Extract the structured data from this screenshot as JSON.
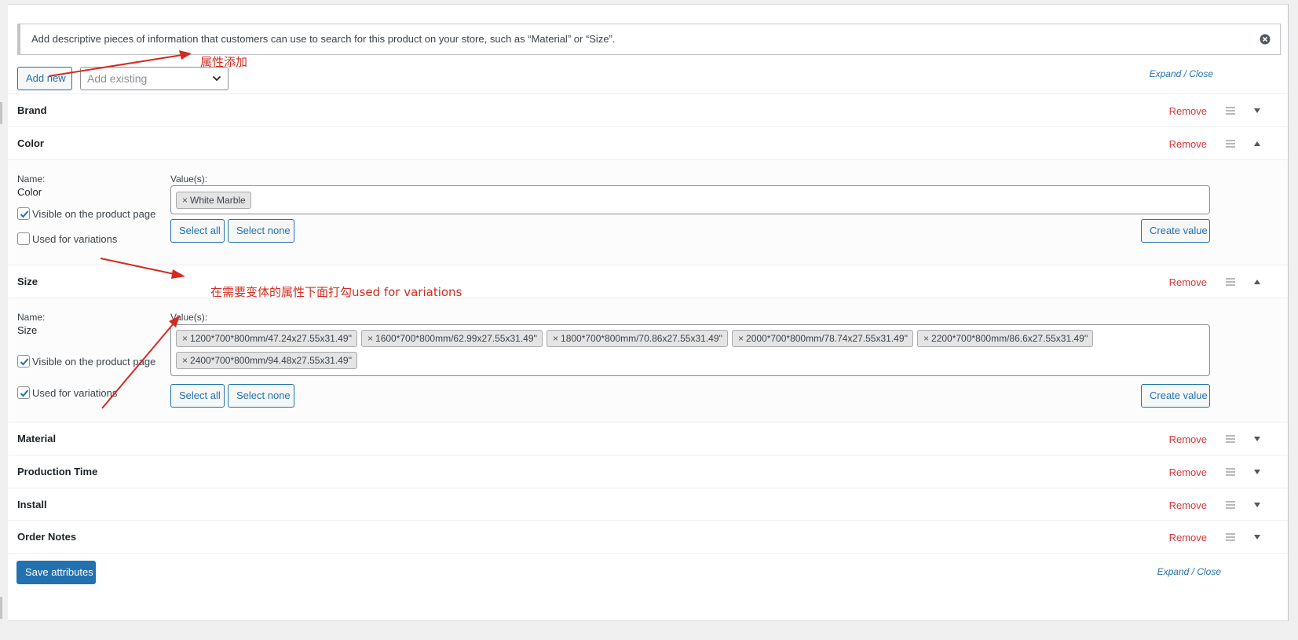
{
  "notice": {
    "text": "Add descriptive pieces of information that customers can use to search for this product on your store, such as “Material” or “Size”."
  },
  "toolbar": {
    "add_new_label": "Add new",
    "add_existing_placeholder": "Add existing",
    "expand_label": "Expand",
    "separator": " / ",
    "close_label": "Close"
  },
  "annotations": {
    "add_attribute": "属性添加",
    "check_variations": "在需要变体的属性下面打勾used for variations"
  },
  "attributes": [
    {
      "title": "Brand",
      "remove_label": "Remove"
    },
    {
      "title": "Color",
      "remove_label": "Remove",
      "name_label": "Name:",
      "name_value": "Color",
      "visible_label": "Visible on the product page",
      "visible_checked": true,
      "variations_label": "Used for variations",
      "variations_checked": false,
      "values_label": "Value(s):",
      "values": [
        "White Marble"
      ],
      "select_all_label": "Select all",
      "select_none_label": "Select none",
      "create_value_label": "Create value"
    },
    {
      "title": "Size",
      "remove_label": "Remove",
      "name_label": "Name:",
      "name_value": "Size",
      "visible_label": "Visible on the product page",
      "visible_checked": true,
      "variations_label": "Used for variations",
      "variations_checked": true,
      "values_label": "Value(s):",
      "values": [
        "1200*700*800mm/47.24x27.55x31.49''",
        "1600*700*800mm/62.99x27.55x31.49''",
        "1800*700*800mm/70.86x27.55x31.49''",
        "2000*700*800mm/78.74x27.55x31.49''",
        "2200*700*800mm/86.6x27.55x31.49''",
        "2400*700*800mm/94.48x27.55x31.49''"
      ],
      "select_all_label": "Select all",
      "select_none_label": "Select none",
      "create_value_label": "Create value"
    },
    {
      "title": "Material",
      "remove_label": "Remove"
    },
    {
      "title": "Production Time",
      "remove_label": "Remove"
    },
    {
      "title": "Install",
      "remove_label": "Remove"
    },
    {
      "title": "Order Notes",
      "remove_label": "Remove"
    }
  ],
  "footer": {
    "save_label": "Save attributes",
    "expand_label": "Expand",
    "separator": " / ",
    "close_label": "Close"
  },
  "colors": {
    "accent": "#2271b1",
    "remove": "#d63638",
    "annotation": "#d42b20"
  }
}
